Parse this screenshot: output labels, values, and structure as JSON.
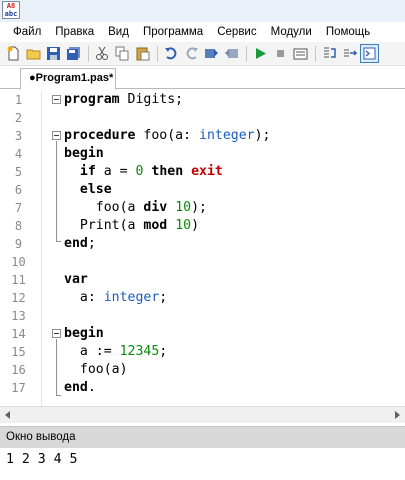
{
  "app": {
    "icon_text_top": "A8",
    "icon_text_bottom": "abc"
  },
  "menu": [
    "Файл",
    "Правка",
    "Вид",
    "Программа",
    "Сервис",
    "Модули",
    "Помощь"
  ],
  "toolbar": {
    "buttons": [
      "new-file-icon",
      "open-folder-icon",
      "save-icon",
      "save-all-icon",
      "cut-icon",
      "copy-icon",
      "paste-icon",
      "undo-icon",
      "redo-icon",
      "run-back-icon",
      "run-forward-icon",
      "run-icon",
      "stop-icon",
      "compile-icon",
      "step-into-icon",
      "step-over-icon",
      "output-window-icon"
    ]
  },
  "tabs": [
    {
      "label": "●Program1.pas*",
      "active": true
    }
  ],
  "editor": {
    "line_numbers": [
      "1",
      "2",
      "3",
      "4",
      "5",
      "6",
      "7",
      "8",
      "9",
      "10",
      "11",
      "12",
      "13",
      "14",
      "15",
      "16",
      "17"
    ],
    "lines": [
      [
        {
          "t": "program",
          "c": "kw"
        },
        {
          "t": " Digits;",
          "c": ""
        }
      ],
      [],
      [
        {
          "t": "procedure",
          "c": "kw"
        },
        {
          "t": " foo(a: ",
          "c": ""
        },
        {
          "t": "integer",
          "c": "ty"
        },
        {
          "t": ");",
          "c": ""
        }
      ],
      [
        {
          "t": "begin",
          "c": "kw"
        }
      ],
      [
        {
          "t": "  ",
          "c": ""
        },
        {
          "t": "if",
          "c": "kw"
        },
        {
          "t": " a = ",
          "c": ""
        },
        {
          "t": "0",
          "c": "num"
        },
        {
          "t": " ",
          "c": ""
        },
        {
          "t": "then",
          "c": "kw"
        },
        {
          "t": " ",
          "c": ""
        },
        {
          "t": "exit",
          "c": "ex"
        }
      ],
      [
        {
          "t": "  ",
          "c": ""
        },
        {
          "t": "else",
          "c": "kw"
        }
      ],
      [
        {
          "t": "    foo(a ",
          "c": ""
        },
        {
          "t": "div",
          "c": "kw"
        },
        {
          "t": " ",
          "c": ""
        },
        {
          "t": "10",
          "c": "num"
        },
        {
          "t": ");",
          "c": ""
        }
      ],
      [
        {
          "t": "  Print(a ",
          "c": ""
        },
        {
          "t": "mod",
          "c": "kw"
        },
        {
          "t": " ",
          "c": ""
        },
        {
          "t": "10",
          "c": "num"
        },
        {
          "t": ")",
          "c": ""
        }
      ],
      [
        {
          "t": "end",
          "c": "kw"
        },
        {
          "t": ";",
          "c": ""
        }
      ],
      [],
      [
        {
          "t": "var",
          "c": "kw"
        }
      ],
      [
        {
          "t": "  a: ",
          "c": ""
        },
        {
          "t": "integer",
          "c": "ty"
        },
        {
          "t": ";",
          "c": ""
        }
      ],
      [],
      [
        {
          "t": "begin",
          "c": "kw"
        }
      ],
      [
        {
          "t": "  a := ",
          "c": ""
        },
        {
          "t": "12345",
          "c": "num"
        },
        {
          "t": ";",
          "c": ""
        }
      ],
      [
        {
          "t": "  foo(a)",
          "c": ""
        }
      ],
      [
        {
          "t": "end",
          "c": "kw"
        },
        {
          "t": ".",
          "c": ""
        }
      ]
    ]
  },
  "output_panel": {
    "title": "Окно вывода",
    "text": "1 2 3 4 5"
  },
  "colors": {
    "keyword": "#000000",
    "type": "#1a5cc2",
    "number": "#0a8a0a",
    "exit": "#c00000",
    "active_button": "#3c7fb1"
  }
}
